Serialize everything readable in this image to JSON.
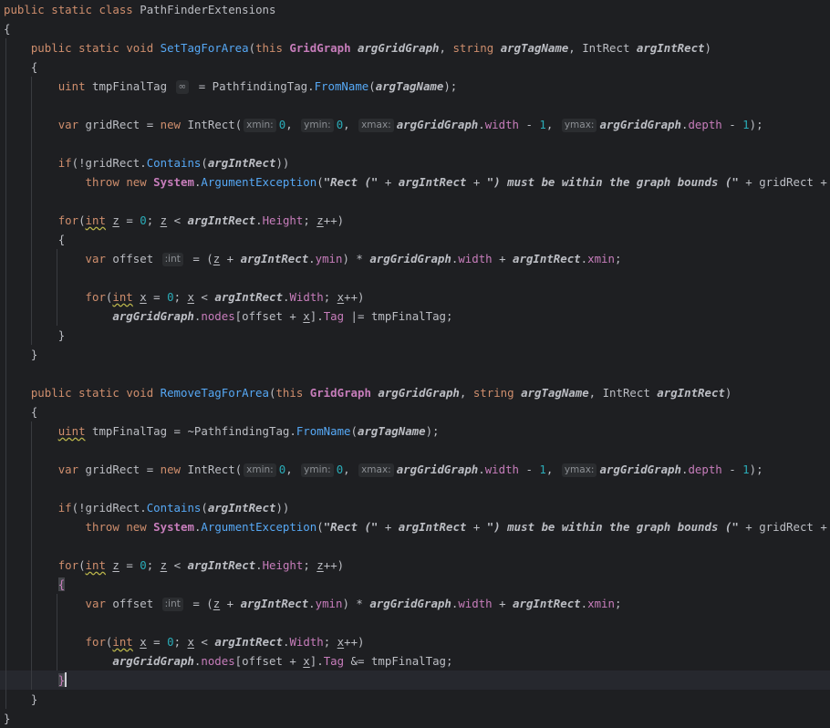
{
  "editor": {
    "class_decl": {
      "kw1": "public",
      "kw2": "static",
      "kw3": "class",
      "name": "PathFinderExtensions"
    },
    "punct": {
      "open_brace": "{",
      "close_brace": "}"
    },
    "m1": {
      "sig_public": "public",
      "sig_static": "static",
      "sig_void": "void",
      "name": "SetTagForArea",
      "this": "this",
      "t_graph": "GridGraph",
      "p_graph": "argGridGraph",
      "t_string": "string",
      "p_tag": "argTagName",
      "t_rect": "IntRect",
      "p_rect": "argIntRect",
      "l_uint": "uint",
      "l_tmp": "tmpFinalTag",
      "hint_icon": "∞",
      "l_tag_class": "PathfindingTag",
      "l_fromname": "FromName",
      "l_tilde": "",
      "var": "var",
      "gridRect": "gridRect",
      "new": "new",
      "IntRect": "IntRect",
      "hint_xmin": "xmin:",
      "hint_ymin": "ymin:",
      "hint_xmax": "xmax:",
      "hint_ymax": "ymax:",
      "zero": "0",
      "one": "1",
      "width": "width",
      "depth": "depth",
      "if": "if",
      "contains": "Contains",
      "throw": "throw",
      "System": "System",
      "ArgumentException": "ArgumentException",
      "s1": "\"Rect (\"",
      "s2": "\") must be within the graph bounds (\"",
      "s3": "\")\"",
      "for": "for",
      "int": "int",
      "z": "z",
      "x": "x",
      "Height": "Height",
      "Width": "Width",
      "offset": "offset",
      "hint_int": ":int",
      "ymin": "ymin",
      "xmin": "xmin",
      "nodes": "nodes",
      "Tag": "Tag",
      "op_tag": "|="
    },
    "m2": {
      "name": "RemoveTagForArea",
      "l_tilde": "~",
      "op_tag": "&="
    }
  }
}
